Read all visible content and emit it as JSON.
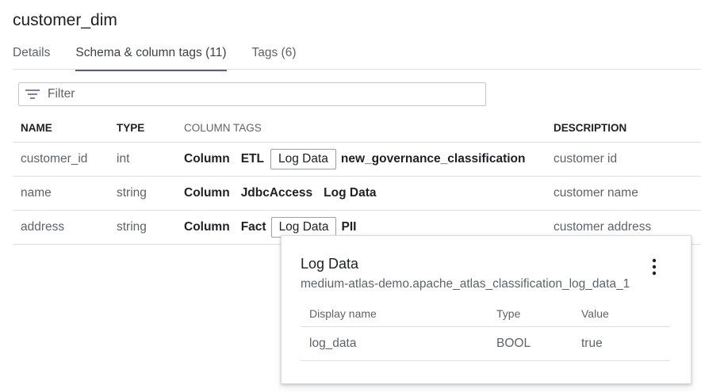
{
  "page": {
    "title": "customer_dim"
  },
  "tabs": [
    {
      "label": "Details",
      "active": false
    },
    {
      "label": "Schema & column tags (11)",
      "active": true
    },
    {
      "label": "Tags (6)",
      "active": false
    }
  ],
  "filter": {
    "placeholder": "Filter",
    "icon": "filter-list-icon"
  },
  "schema": {
    "headers": {
      "name": "NAME",
      "type": "TYPE",
      "column_tags": "COLUMN TAGS",
      "description": "DESCRIPTION"
    },
    "rows": [
      {
        "name": "customer_id",
        "type": "int",
        "tags": [
          "Column",
          "ETL",
          "Log Data",
          "new_governance_classification"
        ],
        "description": "customer id"
      },
      {
        "name": "name",
        "type": "string",
        "tags": [
          "Column",
          "JdbcAccess",
          "Log Data"
        ],
        "description": "customer name"
      },
      {
        "name": "address",
        "type": "string",
        "tags": [
          "Column",
          "Fact",
          "Log Data",
          "PII"
        ],
        "description": "customer address"
      }
    ]
  },
  "popup": {
    "title": "Log Data",
    "subtitle": "medium-atlas-demo.apache_atlas_classification_log_data_1",
    "menu_icon": "more-vert-icon",
    "headers": {
      "display_name": "Display name",
      "type": "Type",
      "value": "Value"
    },
    "rows": [
      {
        "display_name": "log_data",
        "type": "BOOL",
        "value": "true"
      }
    ]
  }
}
